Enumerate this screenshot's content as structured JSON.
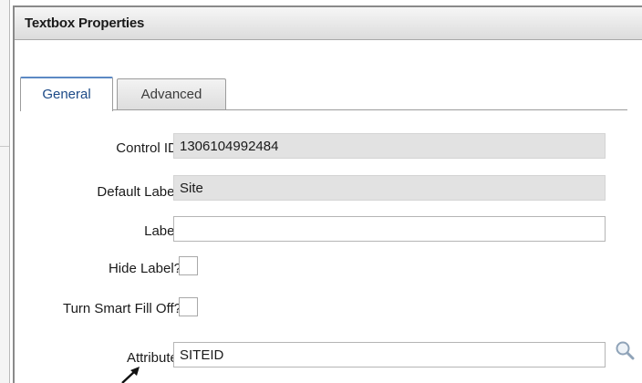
{
  "dialog": {
    "title": "Textbox Properties"
  },
  "tabs": [
    {
      "label": "General",
      "active": true
    },
    {
      "label": "Advanced",
      "active": false
    }
  ],
  "form": {
    "control_id": {
      "label": "Control ID:",
      "value": "1306104992484"
    },
    "default_label": {
      "label": "Default Label:",
      "value": "Site"
    },
    "label": {
      "label": "Label:",
      "value": ""
    },
    "hide_label": {
      "label": "Hide Label?",
      "checked": false
    },
    "smart_fill_off": {
      "label": "Turn Smart Fill Off?",
      "checked": false
    },
    "attribute": {
      "label": "Attribute:",
      "value": "SITEID",
      "lookup_icon": "magnifier-icon"
    }
  },
  "colors": {
    "active_tab_text": "#1c4a87",
    "active_tab_accent": "#5c89c4",
    "readonly_field": "#e2e2e2"
  }
}
